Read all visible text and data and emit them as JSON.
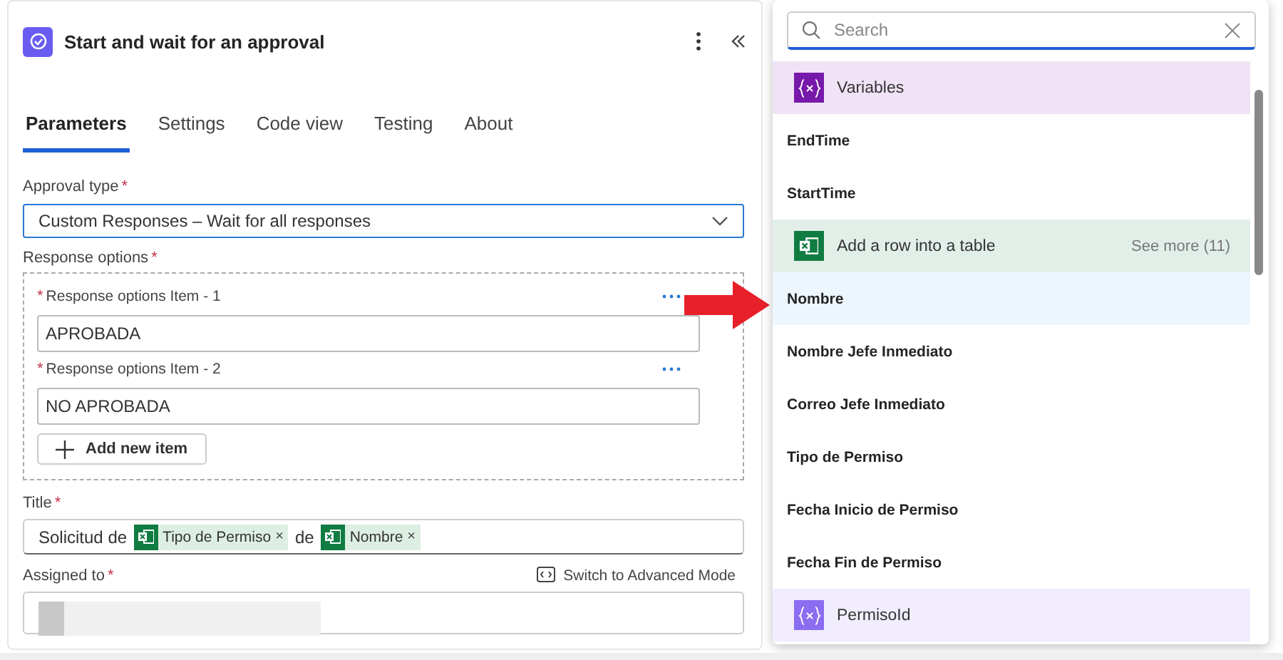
{
  "panel": {
    "title": "Start and wait for an approval",
    "tabs": [
      {
        "label": "Parameters",
        "selected": true
      },
      {
        "label": "Settings",
        "selected": false
      },
      {
        "label": "Code view",
        "selected": false
      },
      {
        "label": "Testing",
        "selected": false
      },
      {
        "label": "About",
        "selected": false
      }
    ],
    "approval_type": {
      "label": "Approval type",
      "required_mark": "*",
      "value": "Custom Responses – Wait for all responses"
    },
    "response_options": {
      "label": "Response options",
      "required_mark": "*",
      "items": [
        {
          "label": "Response options Item - 1",
          "required_mark": "*",
          "value": "APROBADA"
        },
        {
          "label": "Response options Item - 2",
          "required_mark": "*",
          "value": "NO APROBADA"
        }
      ],
      "add_button": "Add new item"
    },
    "title_field": {
      "label": "Title",
      "required_mark": "*",
      "parts": [
        {
          "kind": "text",
          "text": "Solicitud de"
        },
        {
          "kind": "token",
          "text": "Tipo de Permiso",
          "remove": "×"
        },
        {
          "kind": "text",
          "text": "de"
        },
        {
          "kind": "token",
          "text": "Nombre",
          "remove": "×"
        }
      ]
    },
    "assigned_to": {
      "label": "Assigned to",
      "required_mark": "*",
      "switch_link": "Switch to Advanced Mode"
    }
  },
  "picker": {
    "search": {
      "placeholder": "Search"
    },
    "rows": [
      {
        "kind": "group",
        "label": "Variables",
        "color": "#7719aa"
      },
      {
        "kind": "item",
        "label": "EndTime",
        "selected": false
      },
      {
        "kind": "item",
        "label": "StartTime",
        "selected": false
      },
      {
        "kind": "group",
        "label": "Add a row into a table",
        "color": "#107c41",
        "see_more": "See more (11)"
      },
      {
        "kind": "item",
        "label": "Nombre",
        "selected": true
      },
      {
        "kind": "item",
        "label": "Nombre Jefe Inmediato",
        "selected": false
      },
      {
        "kind": "item",
        "label": "Correo Jefe Inmediato",
        "selected": false
      },
      {
        "kind": "item",
        "label": "Tipo de Permiso",
        "selected": false
      },
      {
        "kind": "item",
        "label": "Fecha Inicio de Permiso",
        "selected": false
      },
      {
        "kind": "item",
        "label": "Fecha Fin de Permiso",
        "selected": false
      },
      {
        "kind": "group",
        "label": "PermisoId",
        "color": "#8a6df1"
      }
    ]
  }
}
